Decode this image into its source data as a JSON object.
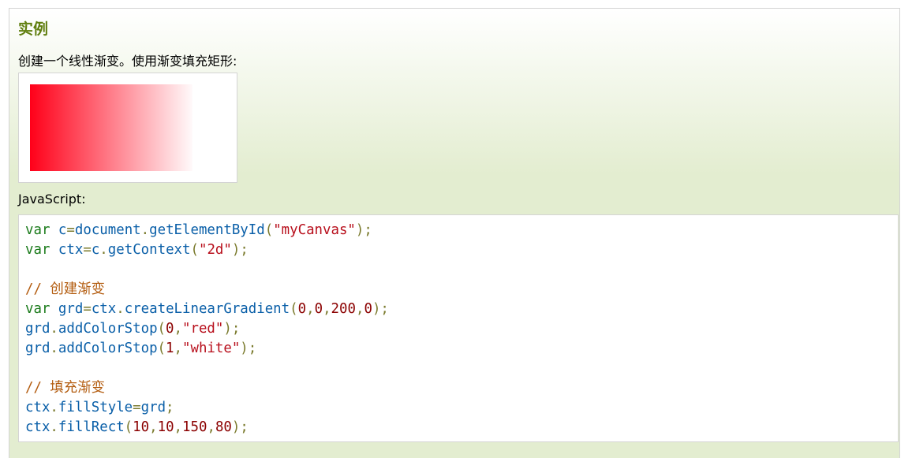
{
  "example": {
    "title": "实例",
    "description": "创建一个线性渐变。使用渐变填充矩形:",
    "js_label": "JavaScript:"
  },
  "preview": {
    "gradient_from": "#ff0019",
    "gradient_to": "#ffffff"
  },
  "code_lines": [
    [
      [
        "kw",
        "var"
      ],
      [
        "t",
        " "
      ],
      [
        "vn",
        "c"
      ],
      [
        "pu",
        "="
      ],
      [
        "vn",
        "document"
      ],
      [
        "pu",
        "."
      ],
      [
        "fn",
        "getElementById"
      ],
      [
        "pu",
        "("
      ],
      [
        "str",
        "\"myCanvas\""
      ],
      [
        "pu",
        ");"
      ]
    ],
    [
      [
        "kw",
        "var"
      ],
      [
        "t",
        " "
      ],
      [
        "vn",
        "ctx"
      ],
      [
        "pu",
        "="
      ],
      [
        "vn",
        "c"
      ],
      [
        "pu",
        "."
      ],
      [
        "fn",
        "getContext"
      ],
      [
        "pu",
        "("
      ],
      [
        "str",
        "\"2d\""
      ],
      [
        "pu",
        ");"
      ]
    ],
    [],
    [
      [
        "cm",
        "// 创建渐变"
      ]
    ],
    [
      [
        "kw",
        "var"
      ],
      [
        "t",
        " "
      ],
      [
        "vn",
        "grd"
      ],
      [
        "pu",
        "="
      ],
      [
        "vn",
        "ctx"
      ],
      [
        "pu",
        "."
      ],
      [
        "fn",
        "createLinearGradient"
      ],
      [
        "pu",
        "("
      ],
      [
        "num",
        "0"
      ],
      [
        "pu",
        ","
      ],
      [
        "num",
        "0"
      ],
      [
        "pu",
        ","
      ],
      [
        "num",
        "200"
      ],
      [
        "pu",
        ","
      ],
      [
        "num",
        "0"
      ],
      [
        "pu",
        ");"
      ]
    ],
    [
      [
        "vn",
        "grd"
      ],
      [
        "pu",
        "."
      ],
      [
        "fn",
        "addColorStop"
      ],
      [
        "pu",
        "("
      ],
      [
        "num",
        "0"
      ],
      [
        "pu",
        ","
      ],
      [
        "str",
        "\"red\""
      ],
      [
        "pu",
        ");"
      ]
    ],
    [
      [
        "vn",
        "grd"
      ],
      [
        "pu",
        "."
      ],
      [
        "fn",
        "addColorStop"
      ],
      [
        "pu",
        "("
      ],
      [
        "num",
        "1"
      ],
      [
        "pu",
        ","
      ],
      [
        "str",
        "\"white\""
      ],
      [
        "pu",
        ");"
      ]
    ],
    [],
    [
      [
        "cm",
        "// 填充渐变"
      ]
    ],
    [
      [
        "vn",
        "ctx"
      ],
      [
        "pu",
        "."
      ],
      [
        "vn",
        "fillStyle"
      ],
      [
        "pu",
        "="
      ],
      [
        "vn",
        "grd"
      ],
      [
        "pu",
        ";"
      ]
    ],
    [
      [
        "vn",
        "ctx"
      ],
      [
        "pu",
        "."
      ],
      [
        "fn",
        "fillRect"
      ],
      [
        "pu",
        "("
      ],
      [
        "num",
        "10"
      ],
      [
        "pu",
        ","
      ],
      [
        "num",
        "10"
      ],
      [
        "pu",
        ","
      ],
      [
        "num",
        "150"
      ],
      [
        "pu",
        ","
      ],
      [
        "num",
        "80"
      ],
      [
        "pu",
        ");"
      ]
    ]
  ]
}
